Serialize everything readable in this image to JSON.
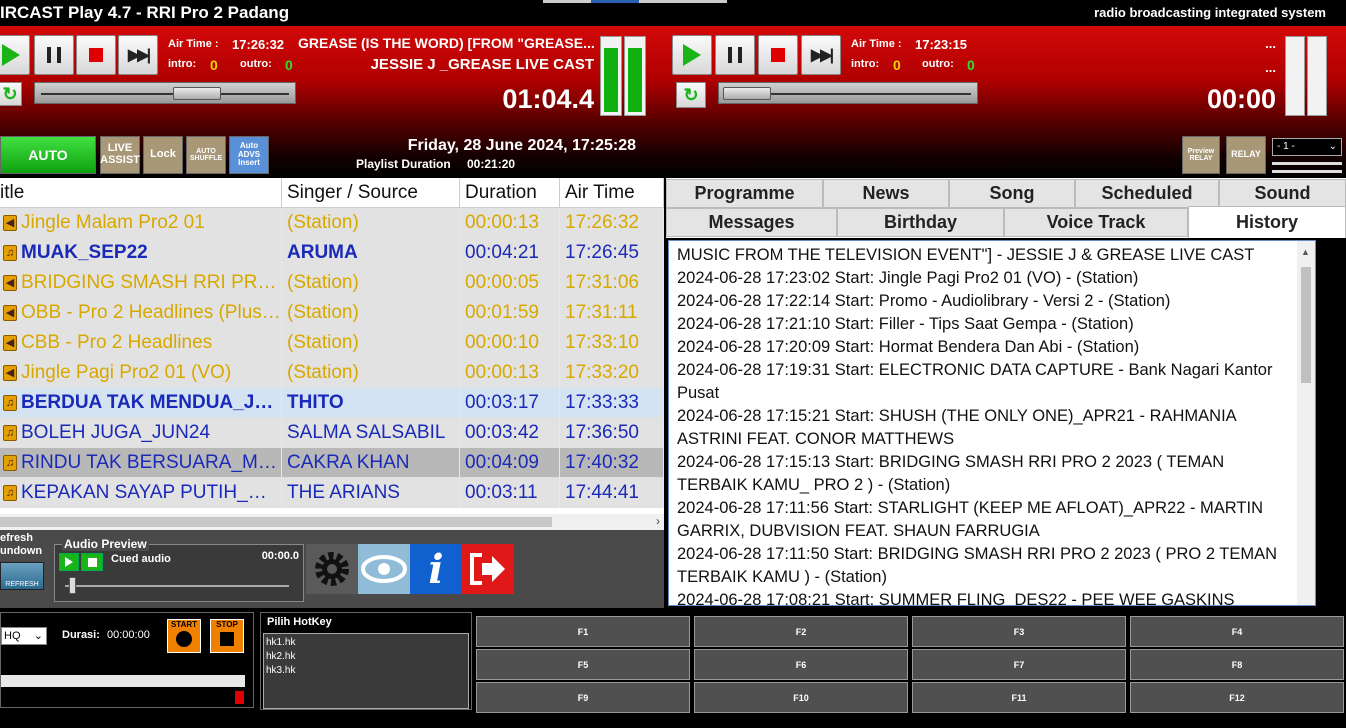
{
  "app": {
    "window_title": "IRCAST Play 4.7 - RRI Pro 2 Padang",
    "tagline": "radio broadcasting integrated system"
  },
  "player1": {
    "air_time_label": "Air Time :",
    "air_time": "17:26:32",
    "intro_label": "intro:",
    "intro": "0",
    "outro_label": "outro:",
    "outro": "0",
    "title": "GREASE (IS THE WORD) [FROM \"GREASE...",
    "artist": "JESSIE J _GREASE LIVE CAST",
    "elapsed": "01:04.4",
    "vu_left_level": 0.9,
    "vu_right_level": 0.9
  },
  "player2": {
    "air_time_label": "Air Time :",
    "air_time": "17:23:15",
    "intro_label": "intro:",
    "intro": "0",
    "outro_label": "outro:",
    "outro": "0",
    "title": "...",
    "artist": "...",
    "elapsed": "00:00",
    "vu_left_level": 0,
    "vu_right_level": 0
  },
  "modes": {
    "auto": "AUTO",
    "live_assist": "LIVE ASSIST",
    "lock": "Lock",
    "auto_shuffle": "AUTO SHUFFLE",
    "auto_advs": "Auto ADVS Insert",
    "preview_relay": "Preview RELAY",
    "relay": "RELAY",
    "relay_select": "- 1 -"
  },
  "status": {
    "datetime": "Friday, 28 June 2024, 17:25:28",
    "playlist_duration_label": "Playlist Duration",
    "playlist_duration": "00:21:20"
  },
  "playlist": {
    "columns": [
      "itle",
      "Singer / Source",
      "Duration",
      "Air Time"
    ],
    "rows": [
      {
        "title": "Jingle Malam Pro2 01",
        "source": "(Station)",
        "duration": "00:00:13",
        "air_time": "17:26:32",
        "kind": "station"
      },
      {
        "title": "MUAK_SEP22",
        "source": "ARUMA",
        "duration": "00:04:21",
        "air_time": "17:26:45",
        "kind": "song-bold"
      },
      {
        "title": "BRIDGING SMASH RRI PRO ...",
        "source": "(Station)",
        "duration": "00:00:05",
        "air_time": "17:31:06",
        "kind": "station"
      },
      {
        "title": "OBB - Pro 2 Headlines (Plus ...",
        "source": "(Station)",
        "duration": "00:01:59",
        "air_time": "17:31:11",
        "kind": "station"
      },
      {
        "title": "CBB - Pro 2 Headlines",
        "source": "(Station)",
        "duration": "00:00:10",
        "air_time": "17:33:10",
        "kind": "station"
      },
      {
        "title": "Jingle Pagi Pro2 01 (VO)",
        "source": "(Station)",
        "duration": "00:00:13",
        "air_time": "17:33:20",
        "kind": "station"
      },
      {
        "title": "BERDUA TAK MENDUA_JUL...",
        "source": "THITO",
        "duration": "00:03:17",
        "air_time": "17:33:33",
        "kind": "song-selected"
      },
      {
        "title": "BOLEH JUGA_JUN24",
        "source": "SALMA SALSABIL",
        "duration": "00:03:42",
        "air_time": "17:36:50",
        "kind": "song"
      },
      {
        "title": "RINDU TAK BERSUARA_MEI24",
        "source": "CAKRA KHAN",
        "duration": "00:04:09",
        "air_time": "17:40:32",
        "kind": "song-dark"
      },
      {
        "title": "KEPAKAN SAYAP PUTIH_MEI...",
        "source": "THE ARIANS",
        "duration": "00:03:11",
        "air_time": "17:44:41",
        "kind": "song"
      }
    ]
  },
  "bottom_left": {
    "refresh_label": "efresh\nundown",
    "refresh_btn": "REFRESH",
    "audio_preview_label": "Audio Preview",
    "cued_audio": "Cued audio",
    "cued_time": "00:00.0"
  },
  "tabs": {
    "row1": [
      "Programme",
      "News",
      "Song",
      "Scheduled",
      "Sound"
    ],
    "row2": [
      "Messages",
      "Birthday",
      "Voice Track",
      "History"
    ],
    "active": "History"
  },
  "history": [
    "MUSIC FROM THE TELEVISION EVENT\"] - JESSIE J & GREASE LIVE CAST",
    "2024-06-28 17:23:02 Start: Jingle Pagi Pro2 01 (VO) - (Station)",
    "2024-06-28 17:22:14 Start: Promo - Audiolibrary - Versi 2 - (Station)",
    "2024-06-28 17:21:10 Start: Filler - Tips Saat Gempa - (Station)",
    "2024-06-28 17:20:09 Start: Hormat Bendera Dan Abi - (Station)",
    "2024-06-28 17:19:31 Start: ELECTRONIC DATA CAPTURE - Bank Nagari Kantor Pusat",
    "2024-06-28 17:15:21 Start: SHUSH (THE ONLY ONE)_APR21 - RAHMANIA ASTRINI FEAT. CONOR MATTHEWS",
    "2024-06-28 17:15:13 Start: BRIDGING SMASH RRI PRO 2 2023 ( TEMAN TERBAIK KAMU_ PRO 2 ) - (Station)",
    "2024-06-28 17:11:56 Start: STARLIGHT (KEEP ME AFLOAT)_APR22 - MARTIN GARRIX, DUBVISION FEAT. SHAUN FARRUGIA",
    "2024-06-28 17:11:50 Start: BRIDGING SMASH RRI PRO 2 2023 ( PRO 2 TEMAN TERBAIK KAMU ) - (Station)",
    "2024-06-28 17:08:21 Start: SUMMER FLING_DES22 - PEE WEE GASKINS"
  ],
  "recorder": {
    "quality": "HQ",
    "durasi_label": "Durasi:",
    "durasi": "00:00:00",
    "start": "START",
    "stop": "STOP"
  },
  "hotkey": {
    "label": "Pilih HotKey",
    "items": [
      "hk1.hk",
      "hk2.hk",
      "hk3.hk"
    ]
  },
  "fkeys": [
    "F1",
    "F2",
    "F3",
    "F4",
    "F5",
    "F6",
    "F7",
    "F8",
    "F9",
    "F10",
    "F11",
    "F12"
  ],
  "colors": {
    "station_text": "#d8a800",
    "song_text": "#1a2ab8",
    "accent_green": "#10b010",
    "header_red": "#d00808"
  }
}
